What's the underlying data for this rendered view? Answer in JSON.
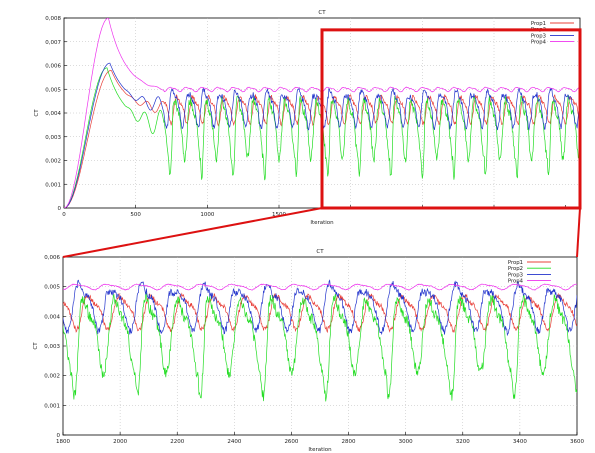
{
  "chart_data": [
    {
      "type": "line",
      "title": "CT",
      "xlabel": "Iteration",
      "ylabel": "CT",
      "xlim": [
        0,
        3600
      ],
      "ylim": [
        0,
        0.008
      ],
      "x_ticks": [
        0,
        500,
        1000,
        1500,
        2000,
        2500,
        3000,
        3500
      ],
      "x_tick_labels": [
        "0",
        "500",
        "1000",
        "1500",
        "",
        "",
        "",
        ""
      ],
      "y_ticks": [
        0,
        0.001,
        0.002,
        0.003,
        0.004,
        0.005,
        0.006,
        0.007,
        0.008
      ],
      "y_tick_labels": [
        "0",
        "0,001",
        "0,002",
        "0,003",
        "0,004",
        "0,005",
        "0,006",
        "0,007",
        "0,008"
      ],
      "grid": true,
      "legend_position": "top-right",
      "series": [
        {
          "name": "Prop1",
          "color": "#e8403a",
          "peak": [
            330,
            0.0058
          ],
          "mean": 0.0042,
          "amp": 0.0005,
          "period": 110,
          "dip": 0
        },
        {
          "name": "Prop2",
          "color": "#22dd22",
          "peak": [
            300,
            0.0059
          ],
          "mean": 0.0035,
          "amp": 0.0011,
          "period": 110,
          "dip": 0.0013
        },
        {
          "name": "Prop3",
          "color": "#2233cc",
          "peak": [
            320,
            0.0061
          ],
          "mean": 0.0043,
          "amp": 0.0007,
          "period": 110,
          "dip": 0.0003
        },
        {
          "name": "Prop4",
          "color": "#ee33ee",
          "peak": [
            310,
            0.008
          ],
          "mean": 0.005,
          "amp": 8e-05,
          "period": 110,
          "dip": 0
        }
      ],
      "highlight_range": {
        "x": [
          1800,
          3600
        ],
        "y": [
          0,
          0.0075
        ],
        "color": "#dd1111"
      }
    },
    {
      "type": "line",
      "title": "CT",
      "xlabel": "Iteration",
      "ylabel": "CT",
      "xlim": [
        1800,
        3600
      ],
      "ylim": [
        0,
        0.006
      ],
      "x_ticks": [
        1800,
        2000,
        2200,
        2400,
        2600,
        2800,
        3000,
        3200,
        3400,
        3600
      ],
      "x_tick_labels": [
        "1800",
        "2000",
        "2200",
        "2400",
        "2600",
        "2800",
        "3000",
        "3200",
        "3400",
        "3600"
      ],
      "y_ticks": [
        0,
        0.001,
        0.002,
        0.003,
        0.004,
        0.005,
        0.006
      ],
      "y_tick_labels": [
        "0",
        "0,001",
        "0,002",
        "0,003",
        "0,004",
        "0,005",
        "0,006"
      ],
      "grid": true,
      "legend_position": "top-right",
      "series": [
        {
          "name": "Prop1",
          "color": "#e8403a",
          "mean": 0.0042,
          "amp": 0.0005,
          "period": 110,
          "dip": 0
        },
        {
          "name": "Prop2",
          "color": "#22dd22",
          "mean": 0.0035,
          "amp": 0.0011,
          "period": 110,
          "dip": 0.0013
        },
        {
          "name": "Prop3",
          "color": "#2233cc",
          "mean": 0.0044,
          "amp": 0.0007,
          "period": 110,
          "dip": 0.0003
        },
        {
          "name": "Prop4",
          "color": "#ee33ee",
          "mean": 0.005,
          "amp": 8e-05,
          "period": 110,
          "dip": 0
        }
      ]
    }
  ]
}
